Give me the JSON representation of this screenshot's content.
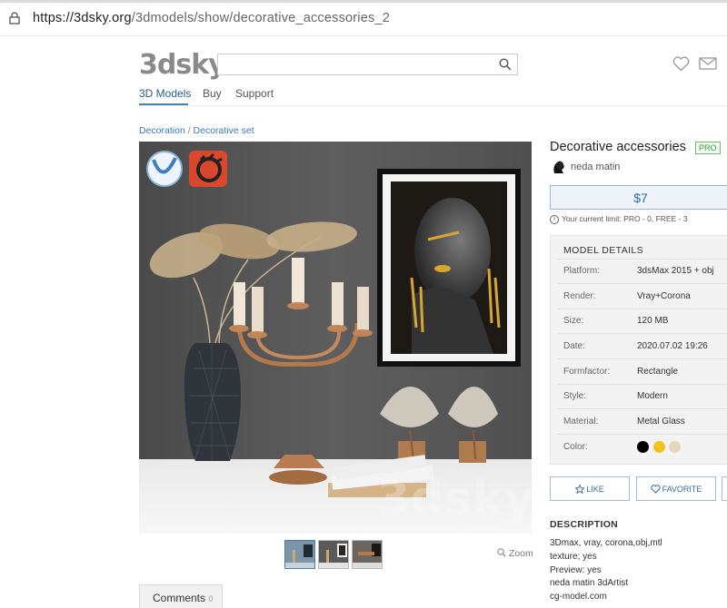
{
  "browser": {
    "url_host": "https://3dsky.org",
    "url_path": "/3dmodels/show/decorative_accessories_2"
  },
  "header": {
    "logo": "3dsky",
    "search": {
      "placeholder": "",
      "value": ""
    },
    "nav": [
      "3D Models",
      "Buy",
      "Support"
    ]
  },
  "breadcrumb": {
    "parent": "Decoration",
    "separator": " / ",
    "current": "Decorative set"
  },
  "product": {
    "title": "Decorative accessories",
    "badge": "PRO",
    "author": "neda matin",
    "price": "$7",
    "limit_text": "Your current limit: PRO - 0, FREE - 3",
    "limit_icon": "i"
  },
  "details": {
    "heading": "MODEL DETAILS",
    "rows": [
      {
        "key": "Platform:",
        "value": "3dsMax 2015 + obj"
      },
      {
        "key": "Render:",
        "value": "Vray+Corona"
      },
      {
        "key": "Size:",
        "value": "120 MB"
      },
      {
        "key": "Date:",
        "value": "2020.07.02 19:26"
      },
      {
        "key": "Formfactor:",
        "value": "Rectangle"
      },
      {
        "key": "Style:",
        "value": "Modern"
      },
      {
        "key": "Material:",
        "value": "Metal Glass"
      },
      {
        "key": "Color:",
        "value": ""
      }
    ],
    "colors": [
      "#000000",
      "#f0c419",
      "#e6d7bd"
    ]
  },
  "actions": {
    "like": "LIKE",
    "favorite": "FAVORITE"
  },
  "description": {
    "heading": "DESCRIPTION",
    "lines": [
      "3Dmax, vray, corona,obj,mtl",
      "texture; yes",
      "Preview: yes",
      "neda matin 3dArtist",
      "cg-model.com"
    ]
  },
  "gallery": {
    "zoom_label": "Zoom",
    "watermark": "3dsky",
    "thumb_count": 3
  },
  "comments": {
    "label": "Comments",
    "count": "0"
  },
  "render_badges": [
    "vray-icon",
    "corona-icon"
  ]
}
